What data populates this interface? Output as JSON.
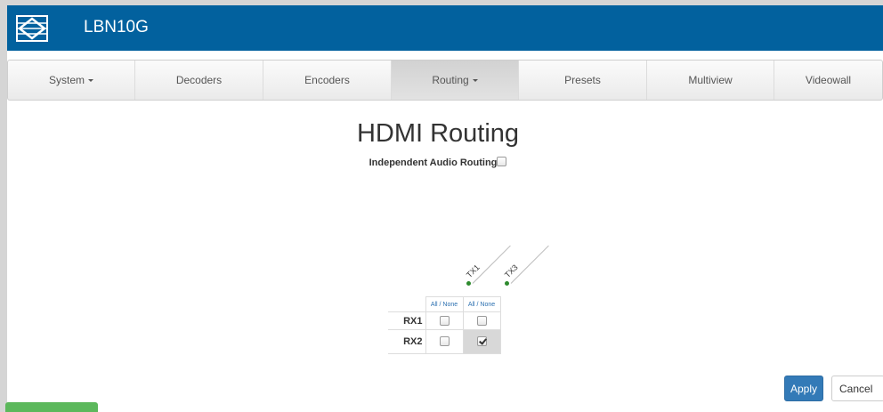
{
  "app": {
    "title": "LBN10G"
  },
  "colors": {
    "header": "#02619e",
    "primary": "#337ab7",
    "tx_status": "#2e8b2e",
    "green_button": "#5cb85c"
  },
  "nav": {
    "items": [
      {
        "label": "System",
        "dropdown": true
      },
      {
        "label": "Decoders",
        "dropdown": false
      },
      {
        "label": "Encoders",
        "dropdown": false
      },
      {
        "label": "Routing",
        "dropdown": true,
        "active": true
      },
      {
        "label": "Presets",
        "dropdown": false
      },
      {
        "label": "Multiview",
        "dropdown": false
      },
      {
        "label": "Videowall",
        "dropdown": false
      }
    ]
  },
  "page": {
    "title": "HDMI Routing",
    "independent_audio_label": "Independent Audio Routing",
    "independent_audio_checked": false
  },
  "matrix": {
    "tx": [
      "TX1",
      "TX3"
    ],
    "all_none_label": "All / None",
    "rows": [
      {
        "label": "RX1",
        "cells": [
          false,
          false
        ]
      },
      {
        "label": "RX2",
        "cells": [
          false,
          true
        ]
      }
    ]
  },
  "actions": {
    "apply_label": "Apply",
    "cancel_label": "Cancel"
  }
}
